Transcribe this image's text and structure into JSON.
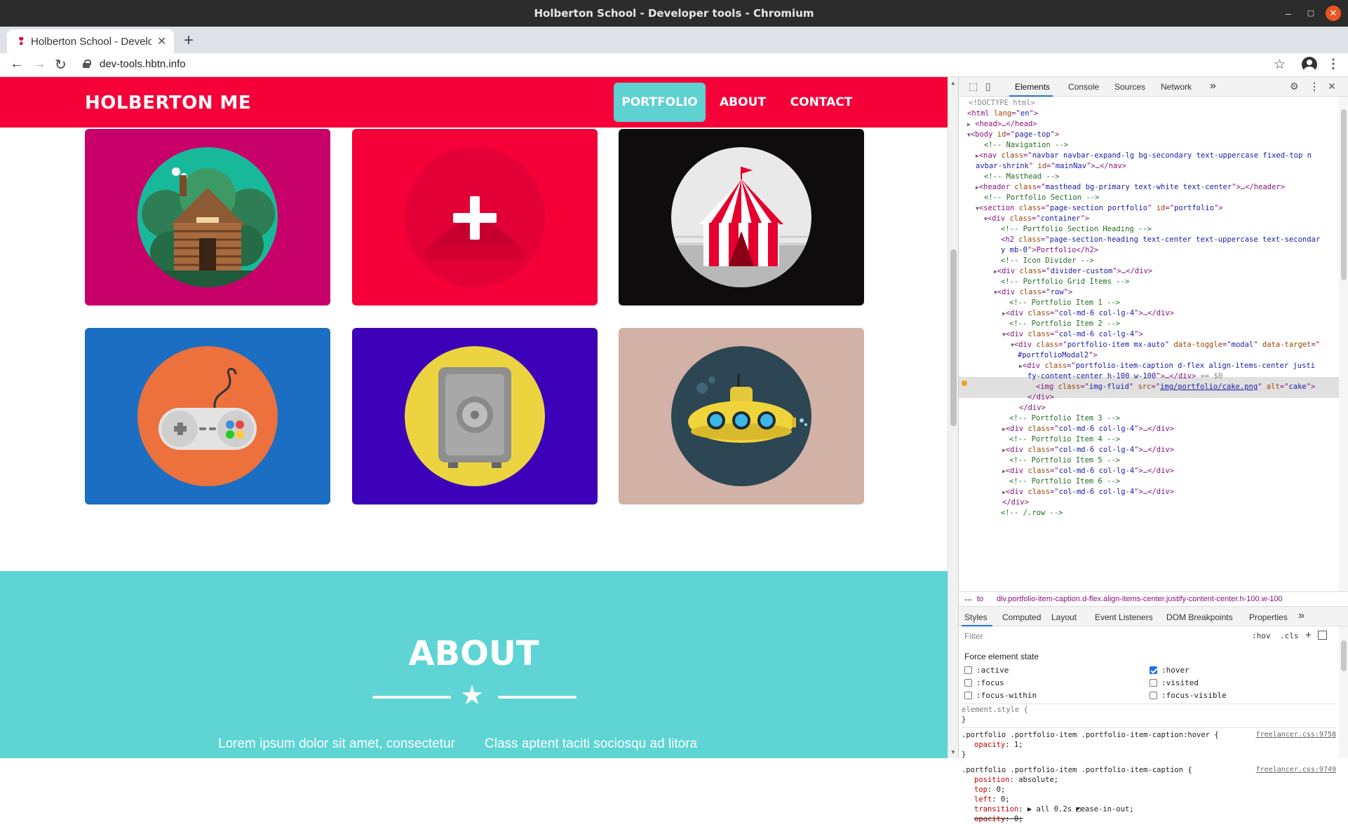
{
  "window": {
    "title": "Holberton School - Developer tools - Chromium",
    "controls": [
      "minimize",
      "maximize",
      "close"
    ]
  },
  "browser": {
    "tab_title": "Holberton School - Developer tools",
    "new_tab_label": "+",
    "url": "dev-tools.hbtn.info"
  },
  "site": {
    "brand": "HOLBERTON ME",
    "nav": [
      {
        "label": "PORTFOLIO",
        "active": true
      },
      {
        "label": "ABOUT",
        "active": false
      },
      {
        "label": "CONTACT",
        "active": false
      }
    ],
    "portfolio": [
      {
        "name": "cabin",
        "bg": "#c8006a"
      },
      {
        "name": "cake",
        "bg": "#f50038",
        "hovered": true
      },
      {
        "name": "circus",
        "bg": "#0e0c0c"
      },
      {
        "name": "game",
        "bg": "#1b6ec2"
      },
      {
        "name": "safe",
        "bg": "#3c00b9"
      },
      {
        "name": "submarine",
        "bg": "#d2b2a6"
      }
    ],
    "about": {
      "title": "ABOUT",
      "text_left": "Lorem ipsum dolor sit amet, consectetur",
      "text_right": "Class aptent taciti sociosqu ad litora"
    },
    "colors": {
      "primary": "#f50038",
      "accent": "#5ed1d1"
    }
  },
  "devtools": {
    "tabs": [
      "Elements",
      "Console",
      "Sources",
      "Network"
    ],
    "active_tab": "Elements",
    "more": "»",
    "dom": {
      "l1": "<!DOCTYPE html>",
      "l2a": "<html ",
      "l2b": "lang",
      "l2c": "=\"",
      "l2d": "en",
      "l2e": "\">",
      "l3": "<head>…</head>",
      "l4a": "<body ",
      "l4b": "id",
      "l4c": "page-top",
      "l5": "<!-- Navigation -->",
      "l6a": "<nav ",
      "l6b": "class",
      "l6c": "navbar navbar-expand-lg bg-secondary text-uppercase fixed-top n",
      "l7a": "avbar-shrink",
      "l7b": "id",
      "l7c": "mainNav",
      "l7d": ">…</nav>",
      "l8": "<!-- Masthead -->",
      "l9a": "<header ",
      "l9b": "class",
      "l9c": "masthead bg-primary text-white text-center",
      "l9d": ">…</header>",
      "l10": "<!-- Portfolio Section -->",
      "l11a": "<section ",
      "l11b": "class",
      "l11c": "page-section portfolio",
      "l11d": "id",
      "l11e": "portfolio",
      "l12a": "<div ",
      "l12b": "class",
      "l12c": "container",
      "l13": "<!-- Portfolio Section Heading -->",
      "l14a": "<h2 ",
      "l14b": "class",
      "l14c": "page-section-heading text-center text-uppercase text-secondar",
      "l15a": "y mb-0",
      "l15b": ">Portfolio</h2>",
      "l16": "<!-- Icon Divider -->",
      "l17a": "<div ",
      "l17b": "class",
      "l17c": "divider-custom",
      "l17d": ">…</div>",
      "l18": "<!-- Portfolio Grid Items -->",
      "l19a": "<div ",
      "l19b": "class",
      "l19c": "row",
      "l20": "<!-- Portfolio Item 1 -->",
      "l21a": "<div ",
      "l21b": "class",
      "l21c": "col-md-6 col-lg-4",
      "l21d": ">…</div>",
      "l22": "<!-- Portfolio Item 2 -->",
      "l23a": "<div ",
      "l23b": "class",
      "l23c": "col-md-6 col-lg-4",
      "l24a": "<div ",
      "l24b": "class",
      "l24c": "portfolio-item mx-auto",
      "l24d": "data-toggle",
      "l24e": "modal",
      "l24f": "data-target",
      "l25a": "#portfolioModal2",
      "l26a": "<div ",
      "l26b": "class",
      "l26c": "portfolio-item-caption d-flex align-items-center justi",
      "l27a": "fy-content-center h-100 w-100",
      "l27b": ">…</div>",
      "l27c": "== $0",
      "l28a": "<img ",
      "l28b": "class",
      "l28c": "img-fluid",
      "l28d": "src",
      "l28e": "img/portfolio/cake.png",
      "l28f": "alt",
      "l28g": "cake",
      "l29": "</div>",
      "l30": "</div>",
      "l31": "<!-- Portfolio Item 3 -->",
      "l32a": "<div ",
      "l32b": "class",
      "l32c": "col-md-6 col-lg-4",
      "l32d": ">…</div>",
      "l33": "<!-- Portfolio Item 4 -->",
      "l34a": "<div ",
      "l34b": "class",
      "l34c": "col-md-6 col-lg-4",
      "l34d": ">…</div>",
      "l35": "<!-- Portfolio Item 5 -->",
      "l36a": "<div ",
      "l36b": "class",
      "l36c": "col-md-6 col-lg-4",
      "l36d": ">…</div>",
      "l37": "<!-- Portfolio Item 6 -->",
      "l38a": "<div ",
      "l38b": "class",
      "l38c": "col-md-6 col-lg-4",
      "l38d": ">…</div>",
      "l39": "</div>",
      "l40": "<!-- /.row -->"
    },
    "breadcrumb": {
      "dots": "…",
      "to": "to",
      "path": "div.portfolio-item-caption.d-flex.align-items-center.justify-content-center.h-100.w-100"
    },
    "style_tabs": [
      "Styles",
      "Computed",
      "Layout",
      "Event Listeners",
      "DOM Breakpoints",
      "Properties"
    ],
    "style_tabs_more": "»",
    "filter_placeholder": "Filter",
    "hov": ":hov",
    "cls": ".cls",
    "plus": "+",
    "force_state_title": "Force element state",
    "states": [
      {
        "label": ":active",
        "checked": false
      },
      {
        "label": ":hover",
        "checked": true
      },
      {
        "label": ":focus",
        "checked": false
      },
      {
        "label": ":visited",
        "checked": false
      },
      {
        "label": ":focus-within",
        "checked": false
      },
      {
        "label": ":focus-visible",
        "checked": false
      }
    ],
    "rules": {
      "r0_sel": "element.style {",
      "r0_close": "}",
      "r1_sel": ".portfolio .portfolio-item .portfolio-item-caption:hover {",
      "r1_src": "freelancer.css:9758",
      "r1_p1": "opacity",
      "r1_v1": "1;",
      "r1_close": "}",
      "r2_sel": ".portfolio .portfolio-item .portfolio-item-caption {",
      "r2_src": "freelancer.css:9749",
      "r2_p1": "position",
      "r2_v1": "absolute;",
      "r2_p2": "top",
      "r2_v2": "0;",
      "r2_p3": "left",
      "r2_v3": "0;",
      "r2_p4": "transition",
      "r2_v4": "▶ all 0.2s ◩ease-in-out;",
      "r2_p5": "opacity",
      "r2_v5": "0;"
    }
  }
}
